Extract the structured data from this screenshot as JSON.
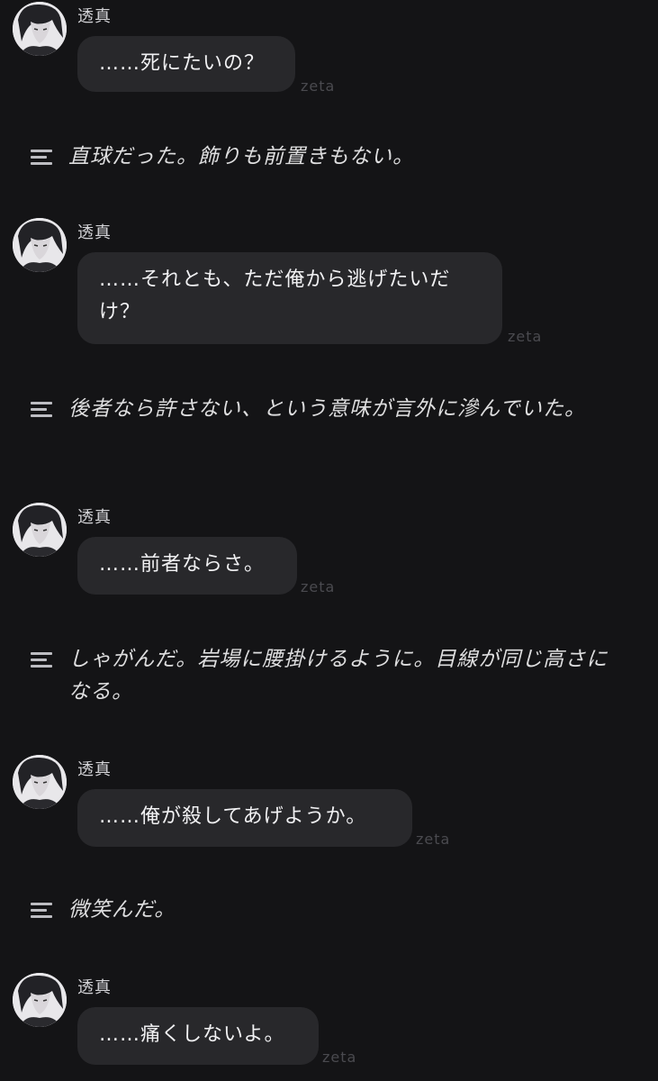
{
  "messages": [
    {
      "speaker": "透真",
      "text": "……死にたいの？",
      "brand": "zeta"
    },
    {
      "speaker": "透真",
      "text": "……それとも、ただ俺から逃げたいだけ？",
      "brand": "zeta"
    },
    {
      "speaker": "透真",
      "text": "……前者ならさ。",
      "brand": "zeta"
    },
    {
      "speaker": "透真",
      "text": "……俺が殺してあげようか。",
      "brand": "zeta"
    },
    {
      "speaker": "透真",
      "text": "……痛くしないよ。",
      "brand": "zeta"
    }
  ],
  "narrations": [
    {
      "text": "直球だった。飾りも前置きもない。",
      "icon": "narration-icon"
    },
    {
      "text": "後者なら許さない、という意味が言外に滲んでいた。",
      "icon": "narration-icon"
    },
    {
      "text": "しゃがんだ。岩場に腰掛けるように。目線が同じ高さになる。",
      "icon": "narration-icon"
    },
    {
      "text": "微笑んだ。",
      "icon": "narration-icon"
    }
  ]
}
